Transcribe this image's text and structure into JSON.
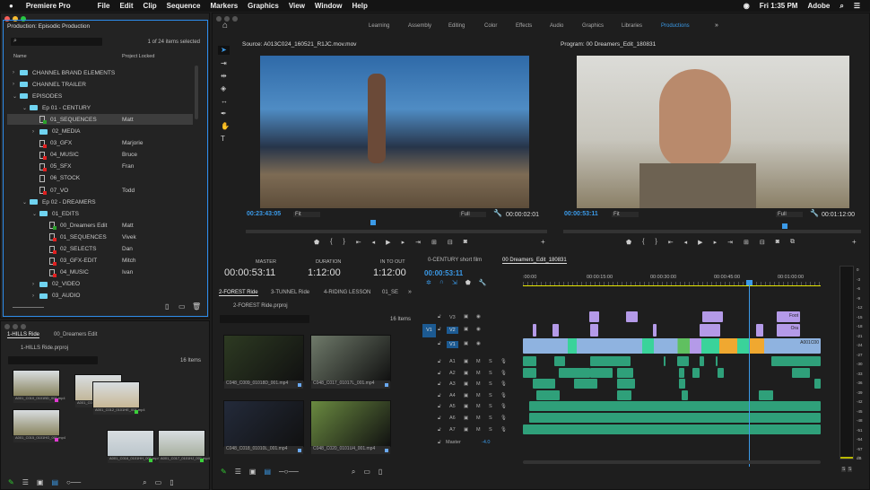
{
  "menubar": {
    "app": "Premiere Pro",
    "items": [
      "File",
      "Edit",
      "Clip",
      "Sequence",
      "Markers",
      "Graphics",
      "View",
      "Window",
      "Help"
    ],
    "clock": "Fri 1:35 PM",
    "user": "Adobe"
  },
  "project": {
    "title": "Production: Episodic Production",
    "selection": "1 of 24 items selected",
    "col_name": "Name",
    "col_locked": "Project Locked",
    "rows": [
      {
        "label": "CHANNEL BRAND ELEMENTS",
        "type": "folder",
        "depth": 0,
        "chev": "›",
        "owner": ""
      },
      {
        "label": "CHANNEL TRAILER",
        "type": "folder",
        "depth": 0,
        "chev": "›",
        "owner": ""
      },
      {
        "label": "EPISODES",
        "type": "folder",
        "depth": 0,
        "chev": "⌄",
        "owner": ""
      },
      {
        "label": "Ep 01 - CENTURY",
        "type": "folder",
        "depth": 1,
        "chev": "⌄",
        "owner": ""
      },
      {
        "label": "01_SEQUENCES",
        "type": "seq",
        "depth": 2,
        "chev": "",
        "owner": "Matt",
        "selected": true
      },
      {
        "label": "02_MEDIA",
        "type": "folder",
        "depth": 2,
        "chev": "›",
        "owner": ""
      },
      {
        "label": "03_GFX",
        "type": "lock",
        "depth": 2,
        "chev": "",
        "owner": "Marjorie"
      },
      {
        "label": "04_MUSIC",
        "type": "lock",
        "depth": 2,
        "chev": "",
        "owner": "Bruce"
      },
      {
        "label": "05_SFX",
        "type": "lock",
        "depth": 2,
        "chev": "",
        "owner": "Fran"
      },
      {
        "label": "06_STOCK",
        "type": "file",
        "depth": 2,
        "chev": "",
        "owner": ""
      },
      {
        "label": "07_VO",
        "type": "lock",
        "depth": 2,
        "chev": "",
        "owner": "Todd"
      },
      {
        "label": "Ep 02 - DREAMERS",
        "type": "folder",
        "depth": 1,
        "chev": "⌄",
        "owner": ""
      },
      {
        "label": "01_EDITS",
        "type": "folder",
        "depth": 2,
        "chev": "⌄",
        "owner": ""
      },
      {
        "label": "00_Dreamers Edit",
        "type": "seq",
        "depth": 3,
        "chev": "",
        "owner": "Matt"
      },
      {
        "label": "01_SEQUENCES",
        "type": "lock",
        "depth": 3,
        "chev": "",
        "owner": "Vivek"
      },
      {
        "label": "02_SELECTS",
        "type": "lock",
        "depth": 3,
        "chev": "",
        "owner": "Dan"
      },
      {
        "label": "03_GFX-EDIT",
        "type": "lock",
        "depth": 3,
        "chev": "",
        "owner": "Mitch"
      },
      {
        "label": "04_MUSIC",
        "type": "lock",
        "depth": 3,
        "chev": "",
        "owner": "Ivan"
      },
      {
        "label": "02_VIDEO",
        "type": "folder",
        "depth": 2,
        "chev": "›",
        "owner": ""
      },
      {
        "label": "03_AUDIO",
        "type": "folder",
        "depth": 2,
        "chev": "›",
        "owner": ""
      }
    ]
  },
  "hills_bin": {
    "tabs": [
      "1-HILLS Ride",
      "00_Dreamers Edit"
    ],
    "path": "1-HILLS Ride.prproj",
    "count": "16 Items",
    "clips": [
      {
        "label": "A001_C010_0101BD_001.mp4",
        "tag": "#e03ad0"
      },
      {
        "label": "A001_C013_0101HF_001.mp4",
        "tag": "#e03ad0"
      },
      {
        "label": "A001_C012_0101HE_001.mp4",
        "tag": "#3ad03a"
      },
      {
        "label": "A001_C015_0101HG_001.mp4",
        "tag": "#e03ad0"
      },
      {
        "label": "A001_C016_0101HH_001.mp4",
        "tag": "#3ad03a"
      },
      {
        "label": "A001_C017_0101HJ_001.mp4",
        "tag": "#3ad03a"
      }
    ]
  },
  "workspaces": {
    "items": [
      "Learning",
      "Assembly",
      "Editing",
      "Color",
      "Effects",
      "Audio",
      "Graphics",
      "Libraries",
      "Productions"
    ],
    "active": "Productions"
  },
  "source": {
    "title": "Source: A013C024_160521_R1JC.mov.mov",
    "timecode": "00:23:43:05",
    "zoom": "Fit",
    "quality": "Full",
    "duration": "00:00:02:01"
  },
  "program": {
    "title": "Program: 00 Dreamers_Edit_180831",
    "timecode": "00:00:53:11",
    "zoom": "Fit",
    "quality": "Full",
    "duration": "00:01:12:00"
  },
  "metadata": {
    "master_label": "MASTER",
    "master": "00:00:53:11",
    "duration_label": "DURATION",
    "duration": "1:12:00",
    "inout_label": "IN TO OUT",
    "inout": "1:12:00"
  },
  "forest_bin": {
    "tabs": [
      "2-FOREST Ride",
      "3-TUNNEL Ride",
      "4-RIDING LESSON",
      "01_SE"
    ],
    "path": "2-FOREST Ride.prproj",
    "count": "16 Items",
    "clips": [
      {
        "label": "C048_C009_01018D_001.mp4"
      },
      {
        "label": "C048_C017_01017L_001.mp4"
      },
      {
        "label": "C048_C018_01010L_001.mp4"
      },
      {
        "label": "C048_C020_0101U4_001.mp4"
      }
    ]
  },
  "timeline": {
    "tabs": [
      "0-CENTURY short film",
      "00 Dreamers_Edit_180831"
    ],
    "active_tab": 1,
    "timecode": "00:00:53:11",
    "ruler": [
      ":00:00",
      "00:00:15:00",
      "00:00:30:00",
      "00:00:45:00",
      "00:01:00:00"
    ],
    "video_tracks": [
      "V3",
      "V2",
      "V1"
    ],
    "source_patch": "V1",
    "audio_tracks": [
      "A1",
      "A2",
      "A3",
      "A4",
      "A5",
      "A6",
      "A7"
    ],
    "master_label": "Master",
    "master_value": "-4.0",
    "clip_labels": {
      "v3": "Foot",
      "v2": "Ora",
      "v1": "A001C00"
    }
  },
  "meter": {
    "scale": [
      "0",
      "-3",
      "-6",
      "-9",
      "-12",
      "-15",
      "-18",
      "-21",
      "-24",
      "-27",
      "-30",
      "-33",
      "-36",
      "-39",
      "-42",
      "-45",
      "-48",
      "-51",
      "-54",
      "-57",
      "dB"
    ],
    "solo": [
      "S",
      "S"
    ]
  },
  "colors": {
    "accent": "#3b9ae8",
    "video_clip": "#8fb3e0",
    "nested": "#b49ae8",
    "audio": "#2fa07a",
    "playhead": "#3b9ae8"
  }
}
